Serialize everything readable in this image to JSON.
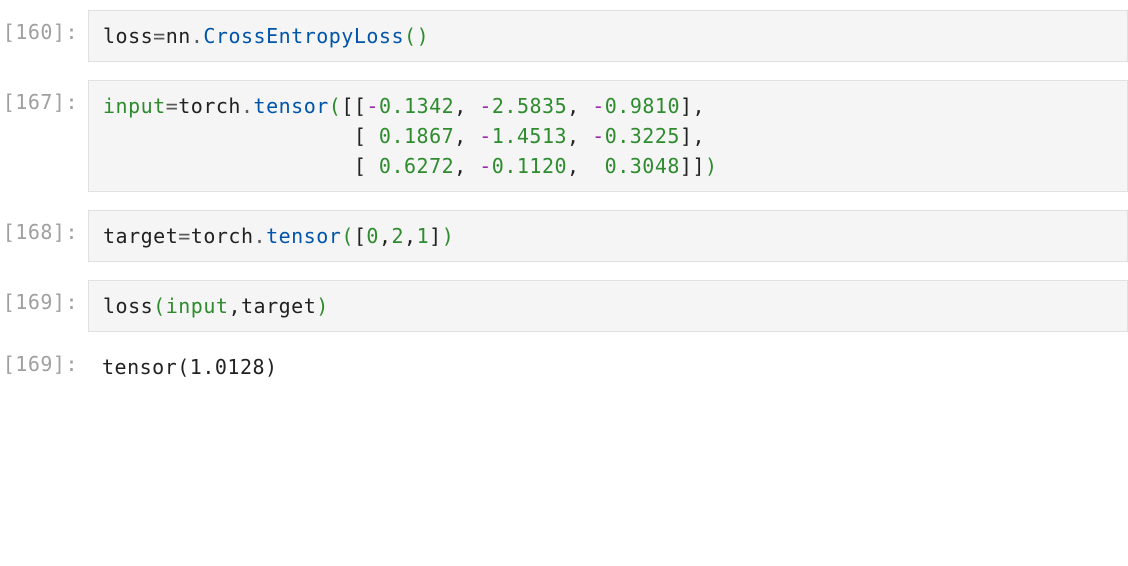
{
  "cells": [
    {
      "prompt": "[160]:",
      "type": "code",
      "tokens": [
        {
          "t": "loss",
          "c": "tok-name"
        },
        {
          "t": "=",
          "c": "tok-assign"
        },
        {
          "t": "nn",
          "c": "tok-name"
        },
        {
          "t": ".",
          "c": "tok-op"
        },
        {
          "t": "CrossEntropyLoss",
          "c": "tok-class"
        },
        {
          "t": "(",
          "c": "tok-paren-g"
        },
        {
          "t": ")",
          "c": "tok-paren-g"
        }
      ]
    },
    {
      "prompt": "[167]:",
      "type": "code",
      "tokens": [
        {
          "t": "input",
          "c": "tok-builtin"
        },
        {
          "t": "=",
          "c": "tok-assign"
        },
        {
          "t": "torch",
          "c": "tok-name"
        },
        {
          "t": ".",
          "c": "tok-op"
        },
        {
          "t": "tensor",
          "c": "tok-func"
        },
        {
          "t": "(",
          "c": "tok-paren-g"
        },
        {
          "t": "[[",
          "c": "tok-name"
        },
        {
          "t": "-",
          "c": "tok-minus"
        },
        {
          "t": "0.1342",
          "c": "tok-num"
        },
        {
          "t": ", ",
          "c": "tok-name"
        },
        {
          "t": "-",
          "c": "tok-minus"
        },
        {
          "t": "2.5835",
          "c": "tok-num"
        },
        {
          "t": ", ",
          "c": "tok-name"
        },
        {
          "t": "-",
          "c": "tok-minus"
        },
        {
          "t": "0.9810",
          "c": "tok-num"
        },
        {
          "t": "],",
          "c": "tok-name"
        },
        {
          "t": "\n                    [ ",
          "c": "tok-name"
        },
        {
          "t": "0.1867",
          "c": "tok-num"
        },
        {
          "t": ", ",
          "c": "tok-name"
        },
        {
          "t": "-",
          "c": "tok-minus"
        },
        {
          "t": "1.4513",
          "c": "tok-num"
        },
        {
          "t": ", ",
          "c": "tok-name"
        },
        {
          "t": "-",
          "c": "tok-minus"
        },
        {
          "t": "0.3225",
          "c": "tok-num"
        },
        {
          "t": "],",
          "c": "tok-name"
        },
        {
          "t": "\n                    [ ",
          "c": "tok-name"
        },
        {
          "t": "0.6272",
          "c": "tok-num"
        },
        {
          "t": ", ",
          "c": "tok-name"
        },
        {
          "t": "-",
          "c": "tok-minus"
        },
        {
          "t": "0.1120",
          "c": "tok-num"
        },
        {
          "t": ",  ",
          "c": "tok-name"
        },
        {
          "t": "0.3048",
          "c": "tok-num"
        },
        {
          "t": "]]",
          "c": "tok-name"
        },
        {
          "t": ")",
          "c": "tok-paren-g"
        }
      ]
    },
    {
      "prompt": "[168]:",
      "type": "code",
      "tokens": [
        {
          "t": "target",
          "c": "tok-name"
        },
        {
          "t": "=",
          "c": "tok-assign"
        },
        {
          "t": "torch",
          "c": "tok-name"
        },
        {
          "t": ".",
          "c": "tok-op"
        },
        {
          "t": "tensor",
          "c": "tok-func"
        },
        {
          "t": "(",
          "c": "tok-paren-g"
        },
        {
          "t": "[",
          "c": "tok-name"
        },
        {
          "t": "0",
          "c": "tok-num"
        },
        {
          "t": ",",
          "c": "tok-name"
        },
        {
          "t": "2",
          "c": "tok-num"
        },
        {
          "t": ",",
          "c": "tok-name"
        },
        {
          "t": "1",
          "c": "tok-num"
        },
        {
          "t": "]",
          "c": "tok-name"
        },
        {
          "t": ")",
          "c": "tok-paren-g"
        }
      ]
    },
    {
      "prompt": "[169]:",
      "type": "code",
      "tokens": [
        {
          "t": "loss",
          "c": "tok-name"
        },
        {
          "t": "(",
          "c": "tok-paren-g"
        },
        {
          "t": "input",
          "c": "tok-builtin"
        },
        {
          "t": ",",
          "c": "tok-name"
        },
        {
          "t": "target",
          "c": "tok-name"
        },
        {
          "t": ")",
          "c": "tok-paren-g"
        }
      ]
    },
    {
      "prompt": "[169]:",
      "type": "output",
      "text": "tensor(1.0128)"
    }
  ]
}
